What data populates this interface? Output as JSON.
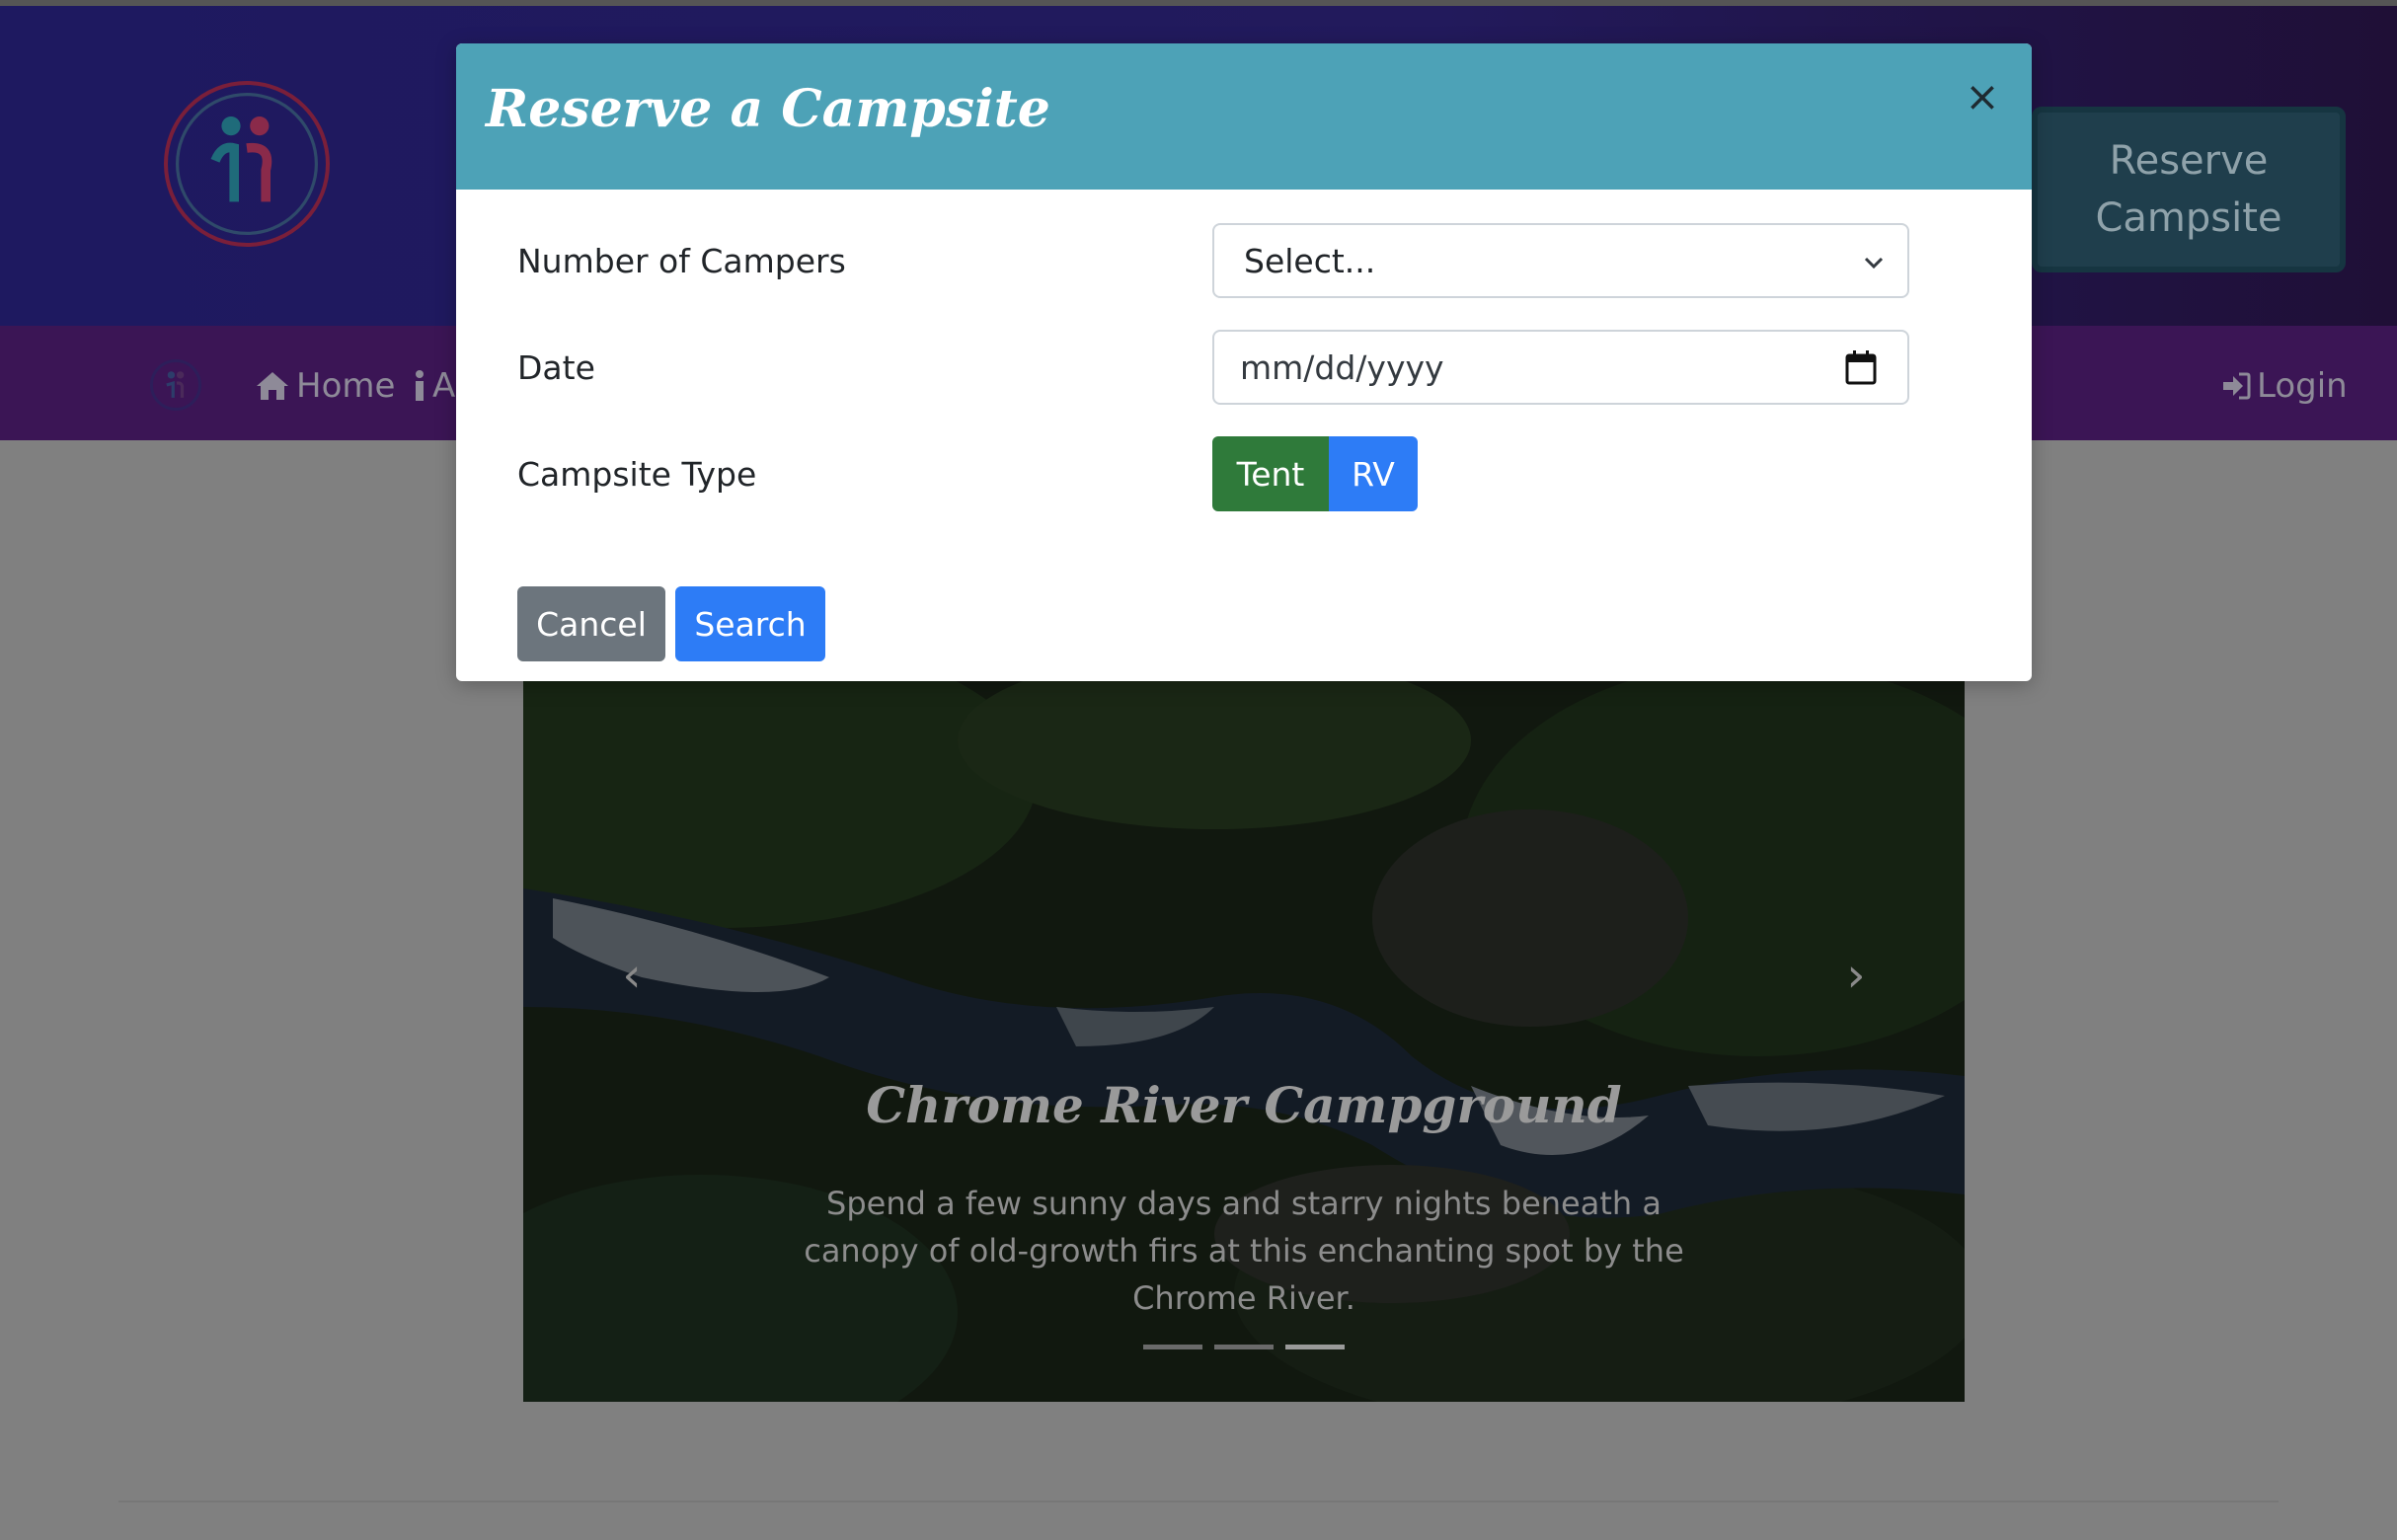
{
  "header": {
    "reserve_button": "Reserve Campsite"
  },
  "navbar": {
    "home": "Home",
    "about_partial": "Al",
    "login": "Login"
  },
  "carousel": {
    "title": "Chrome River Campground",
    "text": "Spend a few sunny days and starry nights beneath a canopy of old-growth firs at this enchanting spot by the Chrome River.",
    "indicator_count": 3,
    "active_indicator": 3
  },
  "modal": {
    "title": "Reserve a Campsite",
    "close": "×",
    "campers_label": "Number of Campers",
    "campers_value": "Select...",
    "date_label": "Date",
    "date_placeholder": "mm/dd/yyyy",
    "type_label": "Campsite Type",
    "type_options": [
      "Tent",
      "RV"
    ],
    "cancel": "Cancel",
    "search": "Search"
  },
  "colors": {
    "modal_header": "#4da2b7",
    "tent": "#2f7a3a",
    "primary": "#2d7cf6",
    "secondary": "#6c757d"
  }
}
